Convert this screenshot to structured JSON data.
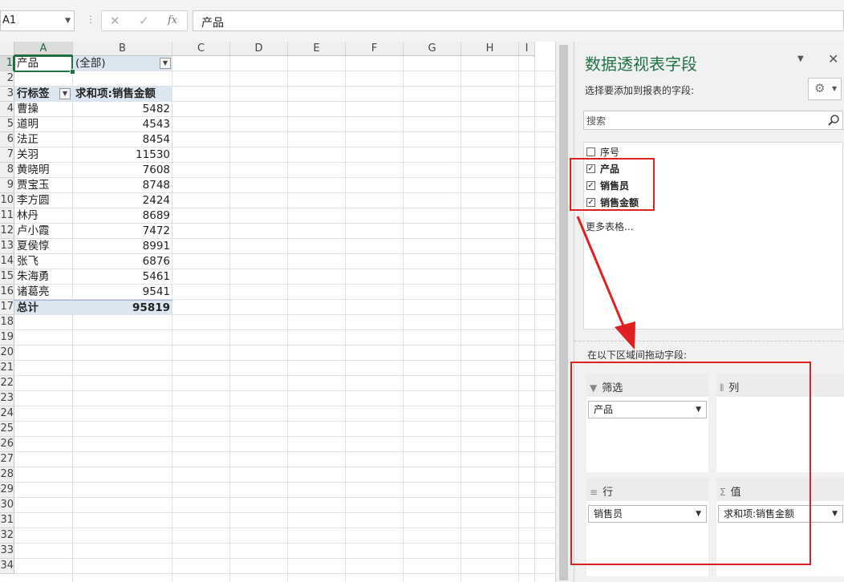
{
  "formula_bar": {
    "name_box": "A1",
    "fx": "fx",
    "formula": "产品"
  },
  "sheet": {
    "columns": [
      "A",
      "B",
      "C",
      "D",
      "E",
      "F",
      "G",
      "H",
      "I"
    ],
    "rows": [
      "1",
      "2",
      "3",
      "4",
      "5",
      "6",
      "7",
      "8",
      "9",
      "10",
      "11",
      "12",
      "13",
      "14",
      "15",
      "16",
      "17",
      "18",
      "19",
      "20",
      "21",
      "22",
      "23",
      "24",
      "25",
      "26",
      "27",
      "28",
      "29",
      "30",
      "31",
      "32",
      "33",
      "34"
    ],
    "filter_label": "产品",
    "filter_value": "(全部)",
    "row_label_header": "行标签",
    "sum_header": "求和项:销售金额",
    "data": [
      {
        "name": "曹操",
        "value": "5482"
      },
      {
        "name": "道明",
        "value": "4543"
      },
      {
        "name": "法正",
        "value": "8454"
      },
      {
        "name": "关羽",
        "value": "11530"
      },
      {
        "name": "黄晓明",
        "value": "7608"
      },
      {
        "name": "贾宝玉",
        "value": "8748"
      },
      {
        "name": "李方圆",
        "value": "2424"
      },
      {
        "name": "林丹",
        "value": "8689"
      },
      {
        "name": "卢小霞",
        "value": "7472"
      },
      {
        "name": "夏侯惇",
        "value": "8991"
      },
      {
        "name": "张飞",
        "value": "6876"
      },
      {
        "name": "朱海勇",
        "value": "5461"
      },
      {
        "name": "诸葛亮",
        "value": "9541"
      }
    ],
    "total_label": "总计",
    "total_value": "95819"
  },
  "pivot_pane": {
    "title": "数据透视表字段",
    "subtitle": "选择要添加到报表的字段:",
    "search_placeholder": "搜索",
    "fields": [
      {
        "label": "序号",
        "checked": false
      },
      {
        "label": "产品",
        "checked": true
      },
      {
        "label": "销售员",
        "checked": true
      },
      {
        "label": "销售金额",
        "checked": true
      }
    ],
    "more_tables": "更多表格...",
    "drag_label": "在以下区域间拖动字段:",
    "areas": {
      "filter": {
        "title": "筛选",
        "item": "产品"
      },
      "columns": {
        "title": "列"
      },
      "rows": {
        "title": "行",
        "item": "销售员"
      },
      "values": {
        "title": "值",
        "item": "求和项:销售金额"
      }
    }
  },
  "colors": {
    "accent": "#217346",
    "annotation": "#e02020",
    "pivot_highlight": "#dce6f1"
  }
}
